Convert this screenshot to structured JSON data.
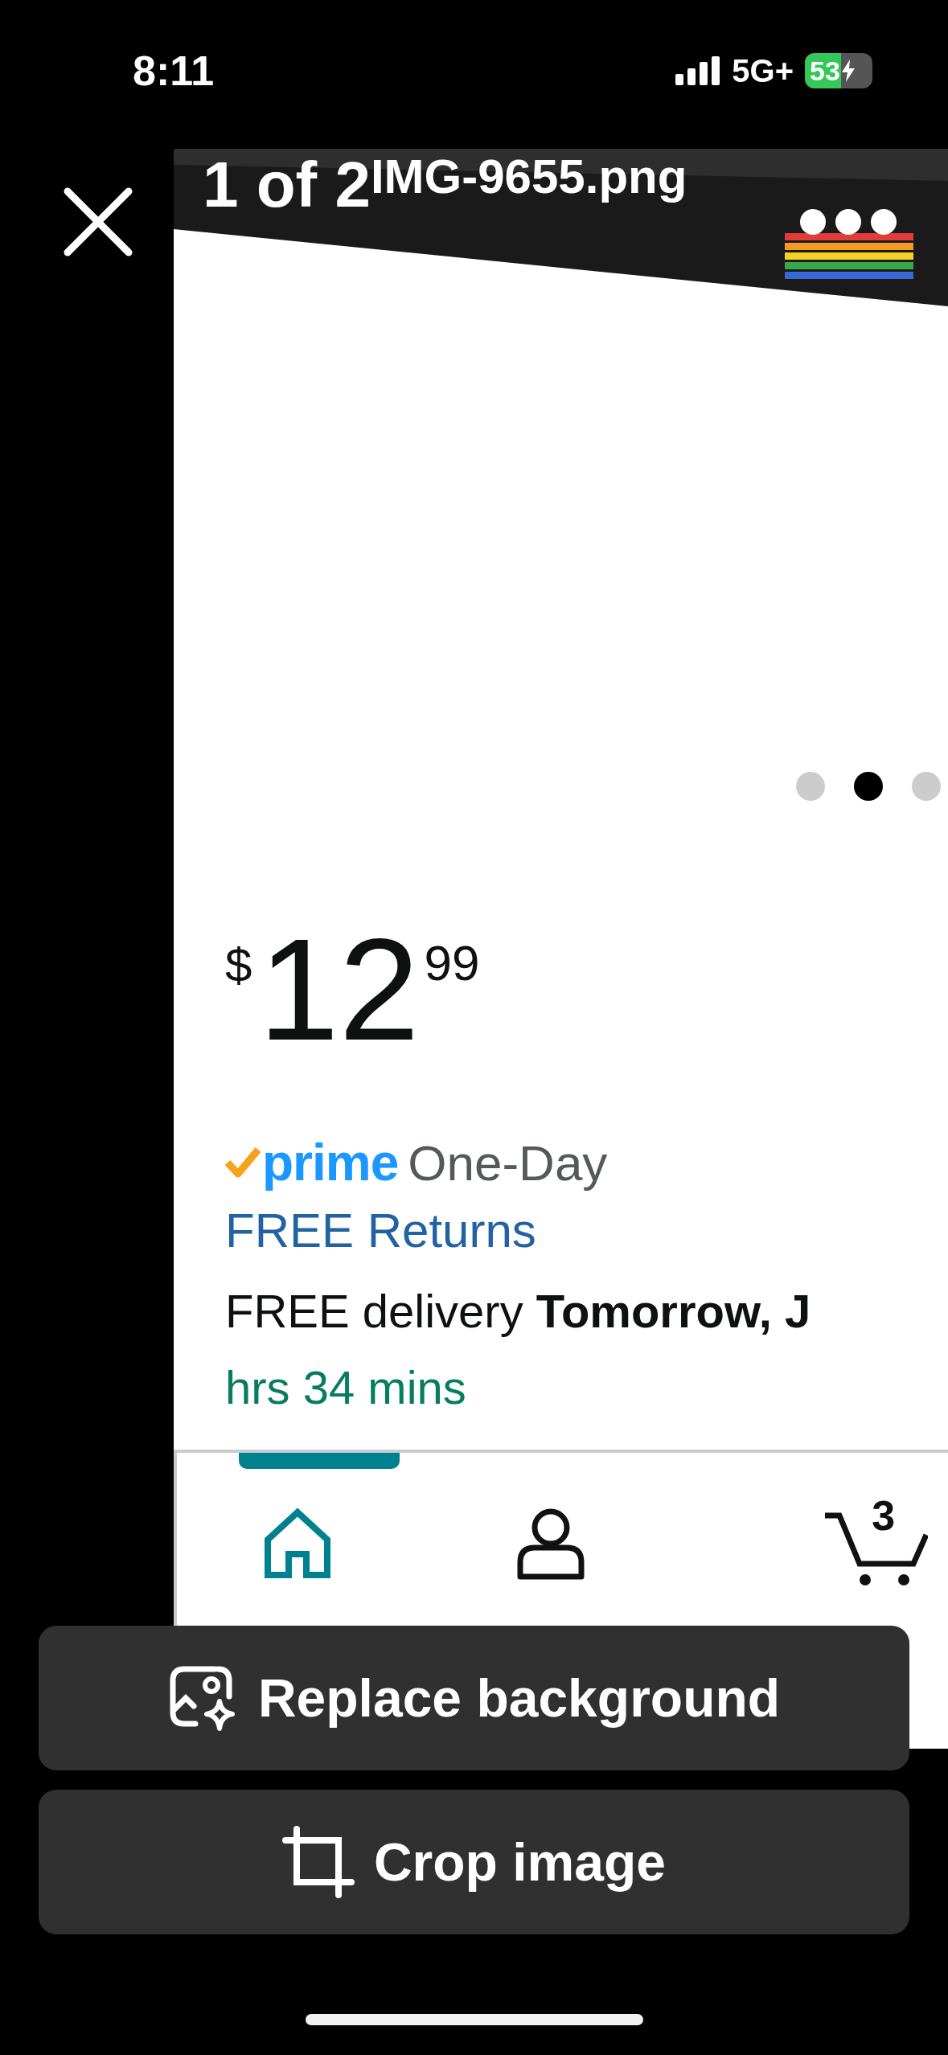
{
  "status_bar": {
    "time": "8:11",
    "network": "5G+",
    "battery": {
      "text": "53",
      "level": 0.53,
      "charging": true
    }
  },
  "viewer": {
    "counter": "1 of 2",
    "filename": "IMG-9655.png"
  },
  "carousel_dots": [
    {
      "selected": false
    },
    {
      "selected": true
    },
    {
      "selected": false
    }
  ],
  "price": {
    "currency": "$",
    "whole": "12",
    "fraction": "99"
  },
  "prime": {
    "logo": "prime",
    "speed": "One-Day"
  },
  "returns": "FREE Returns",
  "delivery": "FREE delivery **Tomorrow, J**",
  "countdown": "hrs 34 mins",
  "nav": [
    {
      "kind": "home",
      "selected": true
    },
    {
      "kind": "account",
      "selected": false
    },
    {
      "kind": "cart",
      "selected": false,
      "badge": "3"
    }
  ],
  "actions": [
    {
      "kind": "replace",
      "label": "Replace background"
    },
    {
      "kind": "crop",
      "label": "Crop image"
    }
  ]
}
